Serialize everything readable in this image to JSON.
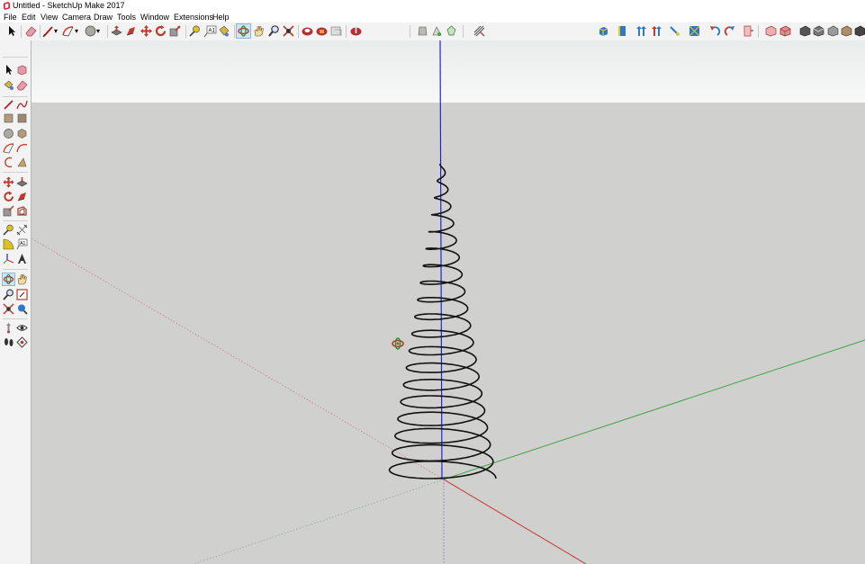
{
  "window": {
    "title": "Untitled - SketchUp Make 2017"
  },
  "menu": {
    "items": [
      "File",
      "Edit",
      "View",
      "Camera",
      "Draw",
      "Tools",
      "Window",
      "Extensions",
      "Help"
    ]
  },
  "toolbar": {
    "active_tool": "orbit",
    "tools": [
      "select",
      "eraser",
      "line",
      "arc",
      "circle",
      "push-pull",
      "follow-me",
      "move",
      "rotate",
      "scale",
      "tape-measure",
      "text",
      "paint-bucket",
      "orbit",
      "pan",
      "zoom",
      "zoom-extents",
      "3d-warehouse",
      "extension-warehouse",
      "layout",
      "share-model",
      "components",
      "styles",
      "shadows",
      "sandbox",
      "iso-view",
      "top-view",
      "front-view",
      "right-view",
      "back-view",
      "left-view",
      "bottom-view",
      "xray",
      "back-edges",
      "wireframe",
      "hidden-line",
      "shaded",
      "shaded-textures",
      "monochrome"
    ]
  },
  "left_toolbar": {
    "active_tool": "orbit",
    "tools": [
      "select",
      "make-component",
      "paint-bucket",
      "eraser",
      "line",
      "freehand",
      "rectangle",
      "rotated-rectangle",
      "circle",
      "polygon",
      "arc",
      "2-point-arc",
      "3-point-arc",
      "pie",
      "move",
      "push-pull",
      "rotate",
      "follow-me",
      "scale",
      "offset",
      "tape-measure",
      "dimension",
      "protractor",
      "text",
      "axes",
      "3d-text",
      "orbit",
      "pan",
      "zoom",
      "zoom-window",
      "zoom-extents",
      "previous",
      "position-camera",
      "look-around",
      "walk",
      "section-plane"
    ]
  },
  "viewport": {
    "sky_color": "#f5f6f6",
    "ground_color": "#d0d0cf",
    "axis_colors": {
      "red": "#c83232",
      "green": "#3fa33f",
      "blue": "#2323d6"
    },
    "model": "conical helix spiral"
  },
  "colors": {
    "toolbar_bg": "#f3f3f3",
    "active_highlight": "#cde3f7"
  }
}
